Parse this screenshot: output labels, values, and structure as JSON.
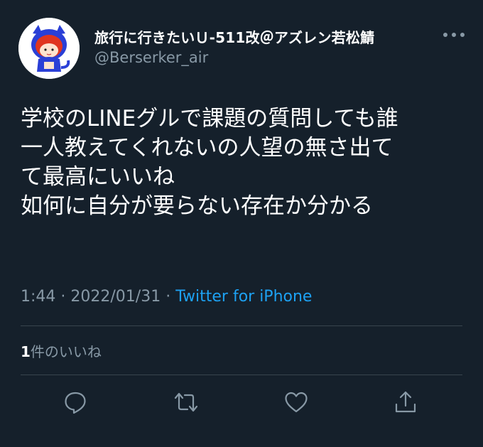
{
  "author": {
    "display_name": "旅行に行きたいＵ-511改＠アズレン若松鯖",
    "handle": "@Berserker_air"
  },
  "tweet": {
    "lines": [
      "学校のLINEグルで課題の質問しても誰",
      "一人教えてくれないの人望の無さ出て",
      "て最高にいいね",
      "如何に自分が要らない存在か分かる"
    ],
    "time": "1:44",
    "date": "2022/01/31",
    "separator": "·",
    "source": "Twitter for iPhone"
  },
  "stats": {
    "like_count": "1",
    "like_label": "件のいいね"
  },
  "actions": {
    "icons": [
      "reply-icon",
      "retweet-icon",
      "like-icon",
      "share-icon"
    ]
  },
  "colors": {
    "background": "#15202b",
    "text": "#ffffff",
    "muted": "#8899a6",
    "link": "#1da1f2",
    "divider": "#38444d"
  }
}
